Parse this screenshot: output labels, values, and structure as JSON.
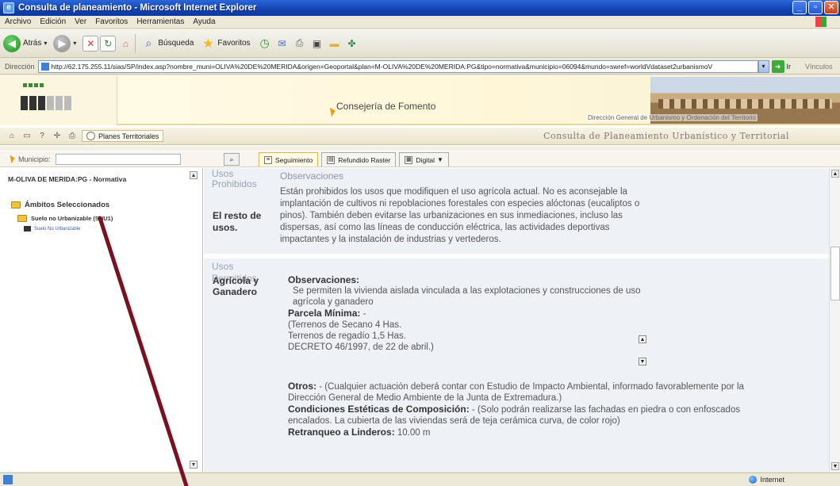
{
  "window": {
    "title": "Consulta de planeamiento - Microsoft Internet Explorer",
    "controls": {
      "minimize": "_",
      "maximize": "▫",
      "close": "✕"
    }
  },
  "menu": [
    "Archivo",
    "Edición",
    "Ver",
    "Favoritos",
    "Herramientas",
    "Ayuda"
  ],
  "toolbar": {
    "back": "Atrás",
    "search": "Búsqueda",
    "favorites": "Favoritos"
  },
  "address": {
    "label": "Dirección",
    "url": "http://62.175.255.11/sias/SP/index.asp?nombre_muni=OLIVA%20DE%20MERIDA&origen=Geoportal&plan=M-OLIVA%20DE%20MERIDA:PG&tipo=normativa&municipio=06094&mundo=swref=worldVdataset2urbanismoV",
    "go": "Ir",
    "links": "Vínculos"
  },
  "banner": {
    "title": "Consejería de Fomento",
    "subtitle": "Dirección General de Urbanismo y Ordenación del Territorio"
  },
  "nav": {
    "planes": "Planes Territoriales",
    "right_title": "Consulta de Planeamiento Urbanístico y Territorial"
  },
  "muni": {
    "label": "Municipio:",
    "tabs": [
      "Seguimiento",
      "Refundido Raster",
      "Digital"
    ]
  },
  "tree": {
    "head": "M-OLIVA DE MERIDA:PG - Normativa",
    "level1": "Ámbitos Seleccionados",
    "level2": "Suelo no Urbanizable (SNU1)",
    "level3": "Suelo No Urbanizable"
  },
  "content": {
    "usos_prohibidos": "Usos Prohibidos",
    "observaciones_head": "Observaciones",
    "resto": "El resto de usos.",
    "prohibidos_text": "Están prohibidos los usos que modifiquen el uso agrícola actual. No es aconsejable la implantación de cultivos ni repoblaciones forestales con especies alóctonas (eucaliptos o pinos). También deben evitarse las urbanizaciones en sus inmediaciones, incluso las dispersas, así como las líneas de conducción eléctrica, las actividades deportivas impactantes y la instalación de industrias y vertederos.",
    "usos_permitidos": "Usos Permitidos",
    "agricola": "Agrícola y Ganadero",
    "obs_label": "Observaciones:",
    "obs_text": "Se permiten la vivienda aislada vinculada a las explotaciones y construcciones de uso agrícola y ganadero",
    "parcela_label": "Parcela Mínima:",
    "parcela_dash": " -",
    "parcela_lines": [
      "(Terrenos de Secano 4 Has.",
      "Terrenos de regadío 1,5 Has.",
      "DECRETO 46/1997, de 22 de abril.)"
    ],
    "otros_label": "Otros:",
    "otros_text": " - (Cualquier actuación deberá contar con Estudio de Impacto Ambiental, informado favorablemente por la Dirección General de Medio Ambiente de la Junta de Extremadura.)",
    "cond_label": "Condiciones Estéticas de Composición:",
    "cond_text": " - (Solo podrán realizarse las fachadas en piedra o con enfoscados encalados. La cubierta de las viviendas será de teja cerámica curva, de color rojo)",
    "retranqueo_label": "Retranqueo a Linderos:",
    "retranqueo_value": " 10.00 m"
  },
  "status": {
    "zone": "Internet"
  },
  "colors": {
    "xp_blue": "#1243b0",
    "banner_orange": "#f29a12",
    "section_bg": "#eef1f6",
    "pointer_line": "#7a1020"
  }
}
